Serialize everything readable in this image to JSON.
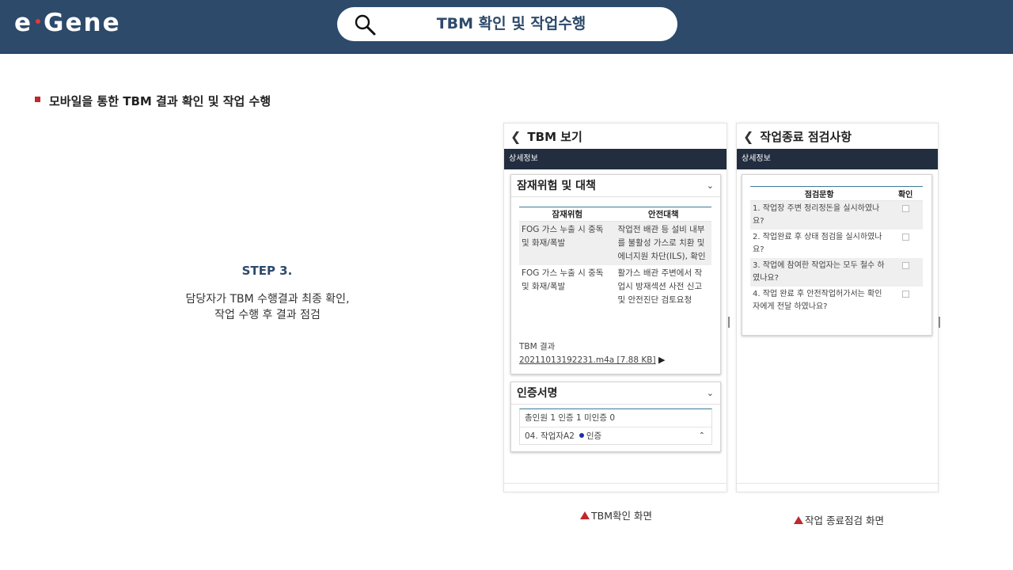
{
  "header": {
    "logo_left": "e",
    "logo_right": "Gene",
    "search_title": "TBM 확인 및 작업수행"
  },
  "section": {
    "title": "모바일을 통한 TBM 결과 확인 및 작업 수행"
  },
  "step": {
    "label": "STEP 3.",
    "desc_line1": "담당자가 TBM 수행결과 최종 확인,",
    "desc_line2": "작업 수행 후 결과 점검"
  },
  "screen1": {
    "back_title": "TBM 보기",
    "bar": "상세정보",
    "risk_card": {
      "title": "잠재위험 및 대책",
      "col_risk": "잠재위험",
      "col_measure": "안전대책",
      "rows": [
        {
          "risk": "FOG 가스 누출 시 중독 및 화재/폭발",
          "measure": "작업전 배관 등 설비 내부를 불활성 가스로 치환 및 에너지원 차단(ILS), 확인"
        },
        {
          "risk": "FOG 가스 누출 시 중독 및 화재/폭발",
          "measure": "활가스 배관 주변에서 작업시 방재섹션 사전 신고 및 안전진단 검토요청"
        }
      ],
      "tbm_label": "TBM 결과",
      "tbm_file": "20211013192231.m4a [7.88 KB]"
    },
    "sign_card": {
      "title": "인증서명",
      "summary": "총인원 1  인증 1  미인증 0",
      "worker": "04. 작업자A2",
      "status": "인증"
    }
  },
  "screen2": {
    "back_title": "작업종료 점검사항",
    "bar": "상세정보",
    "col_item": "점검문항",
    "col_check": "확인",
    "items": [
      "1. 작업장 주변 정리정돈을 실시하였나요?",
      "2. 작업완료 후 상태 점검을 실시하였나요?",
      "3. 작업에 참여한 작업자는 모두 철수 하였나요?",
      "4. 작업 완료 후 안전작업허가서는 확인자에게 전달 하였나요?"
    ]
  },
  "captions": {
    "left": "TBM확인 화면",
    "right": "작업 종료점검 화면"
  },
  "colors": {
    "header_bg": "#2d4a6b",
    "accent_red": "#c0282d",
    "dark_bar": "#222d40",
    "table_rule": "#3c7a99"
  }
}
